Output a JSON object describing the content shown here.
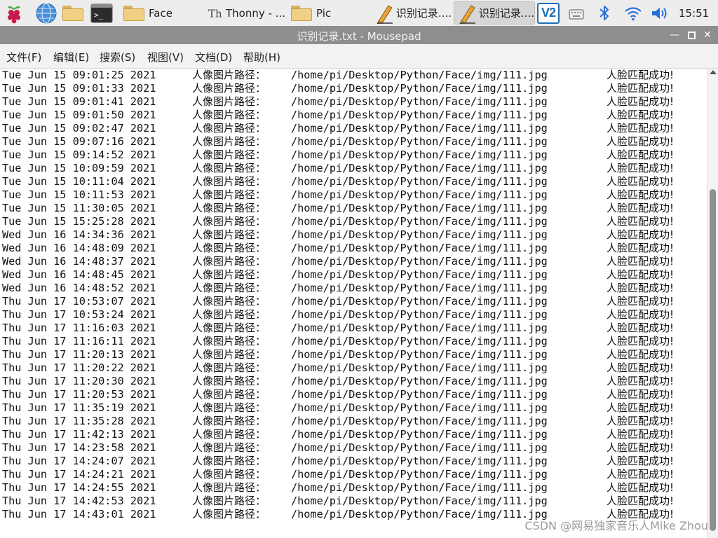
{
  "taskbar": {
    "tasks": [
      {
        "label": "Face",
        "icon": "folder-icon"
      },
      {
        "label": "Thonny  - ...",
        "icon": "thonny-icon"
      },
      {
        "label": "Pic",
        "icon": "folder-icon"
      },
      {
        "label": "识别记录....",
        "icon": "text-editor-icon"
      },
      {
        "label": "识别记录....",
        "icon": "text-editor-icon",
        "active": true
      }
    ],
    "vnc_label": "V2",
    "clock": "15:51"
  },
  "window": {
    "title": "识别记录.txt - Mousepad"
  },
  "menu": [
    "文件(F)",
    "编辑(E)",
    "搜索(S)",
    "视图(V)",
    "文档(D)",
    "帮助(H)"
  ],
  "editor": {
    "label_text": "人像图片路径：",
    "path_text": "/home/pi/Desktop/Python/Face/img/111.jpg",
    "result_text": "人脸匹配成功!",
    "lines": [
      "Tue Jun 15 09:01:25 2021",
      "Tue Jun 15 09:01:33 2021",
      "Tue Jun 15 09:01:41 2021",
      "Tue Jun 15 09:01:50 2021",
      "Tue Jun 15 09:02:47 2021",
      "Tue Jun 15 09:07:16 2021",
      "Tue Jun 15 09:14:52 2021",
      "Tue Jun 15 10:09:59 2021",
      "Tue Jun 15 10:11:04 2021",
      "Tue Jun 15 10:11:53 2021",
      "Tue Jun 15 11:30:05 2021",
      "Tue Jun 15 15:25:28 2021",
      "Wed Jun 16 14:34:36 2021",
      "Wed Jun 16 14:48:09 2021",
      "Wed Jun 16 14:48:37 2021",
      "Wed Jun 16 14:48:45 2021",
      "Wed Jun 16 14:48:52 2021",
      "Thu Jun 17 10:53:07 2021",
      "Thu Jun 17 10:53:24 2021",
      "Thu Jun 17 11:16:03 2021",
      "Thu Jun 17 11:16:11 2021",
      "Thu Jun 17 11:20:13 2021",
      "Thu Jun 17 11:20:22 2021",
      "Thu Jun 17 11:20:30 2021",
      "Thu Jun 17 11:20:53 2021",
      "Thu Jun 17 11:35:19 2021",
      "Thu Jun 17 11:35:28 2021",
      "Thu Jun 17 11:42:13 2021",
      "Thu Jun 17 14:23:58 2021",
      "Thu Jun 17 14:24:07 2021",
      "Thu Jun 17 14:24:21 2021",
      "Thu Jun 17 14:24:55 2021",
      "Thu Jun 17 14:42:53 2021",
      "Thu Jun 17 14:43:01 2021"
    ]
  },
  "watermark": "CSDN @网易独家音乐人Mike Zhou",
  "colors": {
    "titlebar": "#8e8e8e",
    "panel": "#ededed",
    "bluetooth": "#2a6fd6",
    "vnc": "#1f6fb5"
  }
}
